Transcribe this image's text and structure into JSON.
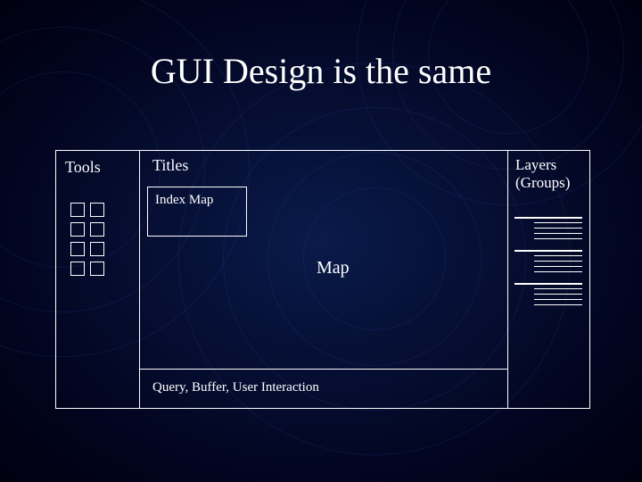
{
  "title": "GUI Design is the same",
  "regions": {
    "tools": "Tools",
    "titles": "Titles",
    "layers": "Layers\n(Groups)",
    "index_map": "Index Map",
    "map": "Map",
    "bottom": "Query, Buffer, User Interaction"
  }
}
